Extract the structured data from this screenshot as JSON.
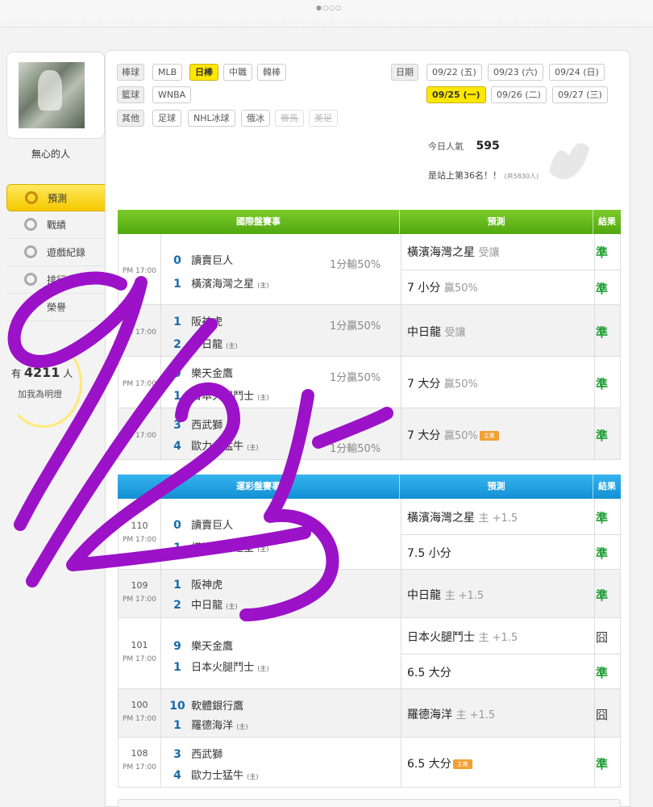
{
  "topbar": {
    "pager": "●○○○"
  },
  "profile": {
    "username": "無心的人",
    "fans_prefix": "有",
    "fans_count": "4211",
    "fans_suffix": "人",
    "fans_action": "加我為明燈"
  },
  "sidebar": {
    "items": [
      {
        "label": "預測"
      },
      {
        "label": "戰績"
      },
      {
        "label": "遊戲紀錄"
      },
      {
        "label": "排行"
      },
      {
        "label": "榮譽"
      }
    ]
  },
  "filters": {
    "baseball_label": "棒球",
    "baseball": [
      "MLB",
      "日棒",
      "中職",
      "韓棒"
    ],
    "basketball_label": "籃球",
    "basketball": [
      "WNBA"
    ],
    "other_label": "其他",
    "other": [
      "足球",
      "NHL冰球",
      "俄冰",
      "賽馬",
      "美足"
    ],
    "date_label": "日期",
    "dates": [
      "09/22 (五)",
      "09/23 (六)",
      "09/24 (日)",
      "09/25 (一)",
      "09/26 (二)",
      "09/27 (三)"
    ]
  },
  "stats": {
    "today_label": "今日人氣",
    "today_value": "595",
    "rank_text": "是站上第36名！！",
    "rank_total": "(共5830人)"
  },
  "intl": {
    "header": {
      "game": "國際盤賽事",
      "pred": "預測",
      "result": "結果"
    },
    "games": [
      {
        "time": "PM 17:00",
        "home_score": "0",
        "home": "讀賣巨人",
        "away_score": "1",
        "away": "橫濱海灣之星",
        "away_tag": "(主)",
        "odds": "1分輸50%",
        "preds": [
          {
            "pick": "橫濱海灣之星",
            "note": "受讓",
            "result": "準"
          },
          {
            "pick": "7 小分",
            "note": "贏50%",
            "result": "準"
          }
        ]
      },
      {
        "time": "PM 17:00",
        "home_score": "1",
        "home": "阪神虎",
        "away_score": "2",
        "away": "中日龍",
        "away_tag": "(主)",
        "odds": "1分贏50%",
        "preds": [
          {
            "pick": "中日龍",
            "note": "受讓",
            "result": "準"
          }
        ]
      },
      {
        "time": "PM 17:00",
        "home_score": "9",
        "home": "樂天金鷹",
        "away_score": "1",
        "away": "日本火腿鬥士",
        "away_tag": "(主)",
        "odds": "1分贏50%",
        "preds": [
          {
            "pick": "7 大分",
            "note": "贏50%",
            "result": "準"
          }
        ]
      },
      {
        "time": "PM 17:00",
        "home_score": "3",
        "home": "西武獅",
        "away_score": "4",
        "away": "歐力士猛牛",
        "away_tag": "(主)",
        "odds": "1分輸50%",
        "preds": [
          {
            "pick": "7 大分",
            "note": "贏50%",
            "tag": "主推",
            "result": "準"
          }
        ]
      }
    ]
  },
  "lottery": {
    "header": {
      "game": "運彩盤賽事",
      "pred": "預測",
      "result": "結果"
    },
    "games": [
      {
        "no": "110",
        "time": "PM 17:00",
        "home_score": "0",
        "home": "讀賣巨人",
        "away_score": "1",
        "away": "橫濱海灣之星",
        "away_tag": "(主)",
        "preds": [
          {
            "pick": "橫濱海灣之星",
            "note": "主 +1.5",
            "result": "準"
          },
          {
            "pick": "7.5 小分",
            "note": "",
            "result": "準"
          }
        ]
      },
      {
        "no": "109",
        "time": "PM 17:00",
        "home_score": "1",
        "home": "阪神虎",
        "away_score": "2",
        "away": "中日龍",
        "away_tag": "(主)",
        "preds": [
          {
            "pick": "中日龍",
            "note": "主 +1.5",
            "result": "準"
          }
        ]
      },
      {
        "no": "101",
        "time": "PM 17:00",
        "home_score": "9",
        "home": "樂天金鷹",
        "away_score": "1",
        "away": "日本火腿鬥士",
        "away_tag": "(主)",
        "preds": [
          {
            "pick": "日本火腿鬥士",
            "note": "主 +1.5",
            "result": "囧"
          },
          {
            "pick": "6.5 大分",
            "note": "",
            "result": "準"
          }
        ]
      },
      {
        "no": "100",
        "time": "PM 17:00",
        "home_score": "10",
        "home": "軟體銀行鷹",
        "away_score": "1",
        "away": "羅德海洋",
        "away_tag": "(主)",
        "preds": [
          {
            "pick": "羅德海洋",
            "note": "主 +1.5",
            "result": "囧"
          }
        ]
      },
      {
        "no": "108",
        "time": "PM 17:00",
        "home_score": "3",
        "home": "西武獅",
        "away_score": "4",
        "away": "歐力士猛牛",
        "away_tag": "(主)",
        "preds": [
          {
            "pick": "6.5 大分",
            "note": "",
            "tag": "主推",
            "result": "準"
          }
        ]
      }
    ]
  },
  "colors": {
    "green_header": "#5cb516",
    "blue_header": "#1fa0e0",
    "selected": "#ffe700",
    "hit": "#1e9e34",
    "scrawl": "#9b12c8"
  }
}
